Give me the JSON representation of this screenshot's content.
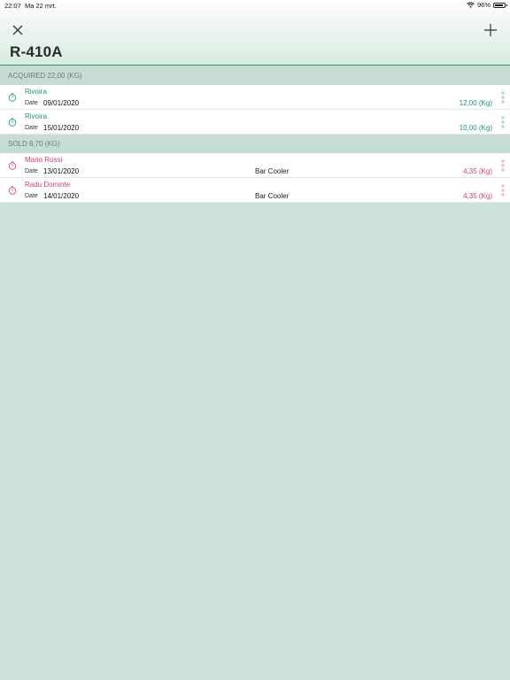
{
  "status": {
    "time": "22:07",
    "date": "Ma 22 mrt.",
    "battery": "96%"
  },
  "header": {
    "title": "R-410A"
  },
  "colors": {
    "accent_green": "#1f9a5e",
    "accent_pink": "#d1416a",
    "bg": "#cde2d8"
  },
  "acquired": {
    "label": "ACQUIRED 22,00 (KG)",
    "items": [
      {
        "name": "Rivoira",
        "date_label": "Date",
        "date": "09/01/2020",
        "qty": "12,00 (Kg)"
      },
      {
        "name": "Rivoira",
        "date_label": "Date",
        "date": "15/01/2020",
        "qty": "10,00 (Kg)"
      }
    ]
  },
  "sold": {
    "label": "SOLD 8,70 (KG)",
    "items": [
      {
        "name": "Mario Rossi",
        "date_label": "Date",
        "date": "13/01/2020",
        "desc": "Bar Cooler",
        "qty": "4,35 (Kg)"
      },
      {
        "name": "Radu Dominte",
        "date_label": "Date",
        "date": "14/01/2020",
        "desc": "Bar Cooler",
        "qty": "4,35 (Kg)"
      }
    ]
  }
}
